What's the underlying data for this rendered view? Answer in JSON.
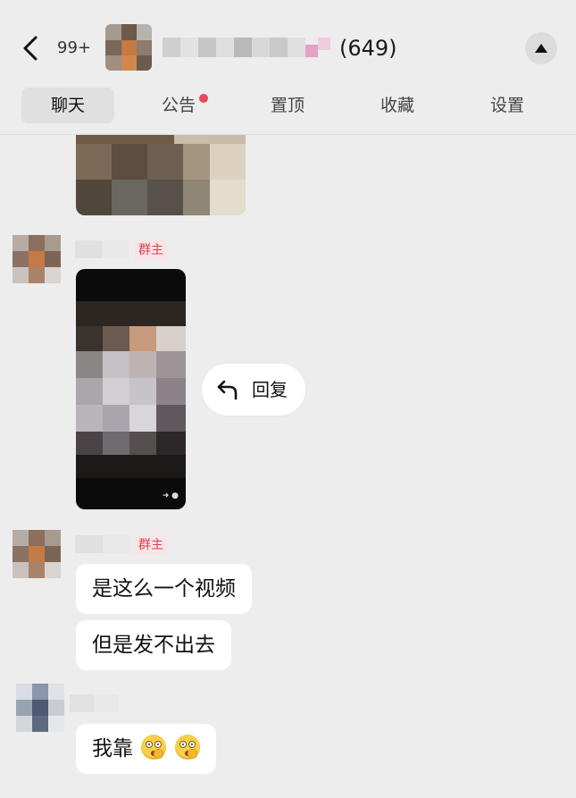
{
  "header": {
    "unread_count": "99+",
    "member_count": "(649)",
    "back_icon": "chevron-left-icon",
    "collapse_icon": "triangle-up-icon"
  },
  "tabs": [
    {
      "label": "聊天",
      "active": true
    },
    {
      "label": "公告",
      "has_dot": true
    },
    {
      "label": "置顶"
    },
    {
      "label": "收藏"
    },
    {
      "label": "设置"
    }
  ],
  "colors": {
    "background": "#ededed",
    "bubble": "#ffffff",
    "badge_text": "#d9424f",
    "badge_bg": "#f8e4e6",
    "notification_dot": "#e9485a"
  },
  "messages": [
    {
      "type": "image",
      "content": "blurred photo"
    },
    {
      "type": "video",
      "sender_badge": "群主"
    },
    {
      "type": "text",
      "sender_badge": "群主",
      "lines": [
        "是这么一个视频",
        "但是发不出去"
      ]
    },
    {
      "type": "text",
      "text": "我靠",
      "emoji_count": 2,
      "emoji": "zipper-mouth-face-icon"
    }
  ],
  "context_action": {
    "label": "回复",
    "icon": "reply-arrow-icon"
  }
}
